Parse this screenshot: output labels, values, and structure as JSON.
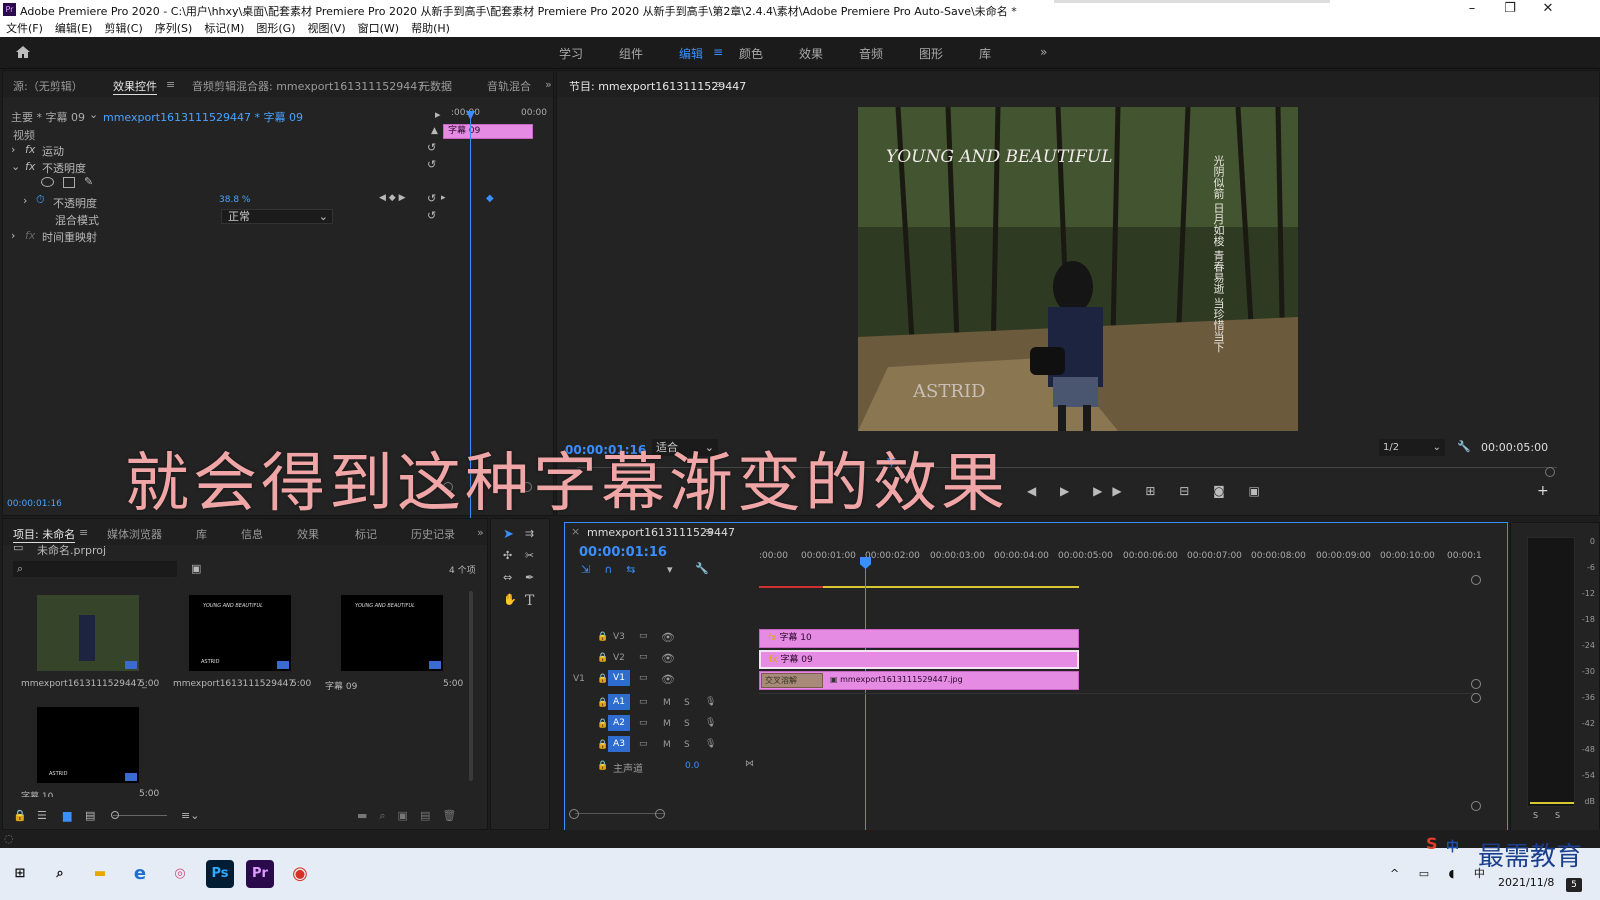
{
  "window": {
    "title": "Adobe Premiere Pro 2020 - C:\\用户\\hhxy\\桌面\\配套素材 Premiere Pro 2020 从新手到高手\\配套素材 Premiere Pro 2020 从新手到高手\\第2章\\2.4.4\\素材\\Adobe Premiere Pro Auto-Save\\未命名 *",
    "app_icon": "Pr",
    "minimize": "–",
    "restore": "❐",
    "close": "✕"
  },
  "menu": [
    "文件(F)",
    "编辑(E)",
    "剪辑(C)",
    "序列(S)",
    "标记(M)",
    "图形(G)",
    "视图(V)",
    "窗口(W)",
    "帮助(H)"
  ],
  "workspaces": {
    "items": [
      "学习",
      "组件",
      "编辑",
      "颜色",
      "效果",
      "音频",
      "图形",
      "库"
    ],
    "active": "编辑",
    "more": "»"
  },
  "source_panel": {
    "tabs": [
      "源:（无剪辑）",
      "效果控件",
      "音频剪辑混合器: mmexport1613111529447",
      "元数据",
      "音轨混合"
    ],
    "active_tab": "效果控件",
    "clip_path_left": "主要 * 字幕 09",
    "clip_path_right": "mmexport1613111529447 * 字幕 09",
    "time_start": ":00:00",
    "time_end": "00:00",
    "mini_clip": "字幕 09",
    "section_video": "视频",
    "fx_motion": "运动",
    "fx_opacity": "不透明度",
    "opacity_label": "不透明度",
    "opacity_value": "38.8 %",
    "blend_label": "混合模式",
    "blend_value": "正常",
    "time_remap": "时间重映射",
    "current_time": "00:00:01:16",
    "fx": "fx"
  },
  "program_monitor": {
    "title": "节目: mmexport1613111529447",
    "timecode": "00:00:01:16",
    "fit": "适合",
    "resolution": "1/2",
    "duration": "00:00:05:00",
    "image_text_title": "YOUNG AND BEAUTIFUL",
    "image_text_sign": "ASTRID",
    "image_vertical_text": "光阴似箭 日月如梭 青春易逝 当珍惜当下"
  },
  "caption_overlay": "就会得到这种字幕渐变的效果",
  "project_panel": {
    "tabs": [
      "项目: 未命名",
      "媒体浏览器",
      "库",
      "信息",
      "效果",
      "标记",
      "历史记录"
    ],
    "active_tab": "项目: 未命名",
    "project_file": "未命名.prproj",
    "item_count": "4 个项",
    "items": [
      {
        "name": "mmexport1613111529447_",
        "duration": "5:00"
      },
      {
        "name": "mmexport1613111529447",
        "duration": "5:00"
      },
      {
        "name": "字幕 09",
        "duration": "5:00"
      },
      {
        "name": "字幕 10",
        "duration": "5:00"
      }
    ]
  },
  "timeline": {
    "tab_title": "mmexport1613111529447",
    "timecode": "00:00:01:16",
    "ruler": [
      ":00:00",
      "00:00:01:00",
      "00:00:02:00",
      "00:00:03:00",
      "00:00:04:00",
      "00:00:05:00",
      "00:00:06:00",
      "00:00:07:00",
      "00:00:08:00",
      "00:00:09:00",
      "00:00:10:00",
      "00:00:1"
    ],
    "tracks_video": [
      "V3",
      "V2",
      "V1"
    ],
    "tracks_audio": [
      "A1",
      "A2",
      "A3"
    ],
    "source_patch": "V1",
    "master": "主声道",
    "master_value": "0.0",
    "clips": {
      "v3": "字幕 10",
      "v2": "字幕 09",
      "v1_transition": "交叉溶解",
      "v1": "mmexport1613111529447.jpg"
    },
    "mute": "M",
    "solo": "S"
  },
  "audio_meter": {
    "labels": [
      "0",
      "-6",
      "-12",
      "-18",
      "-24",
      "-30",
      "-36",
      "-42",
      "-48",
      "-54",
      "dB"
    ],
    "solo_left": "S",
    "solo_right": "S"
  },
  "taskbar": {
    "date": "2021/11/8",
    "ime": "中",
    "watermark": "最需教育",
    "badge": "5",
    "apps": [
      "Ps",
      "Pr"
    ]
  }
}
